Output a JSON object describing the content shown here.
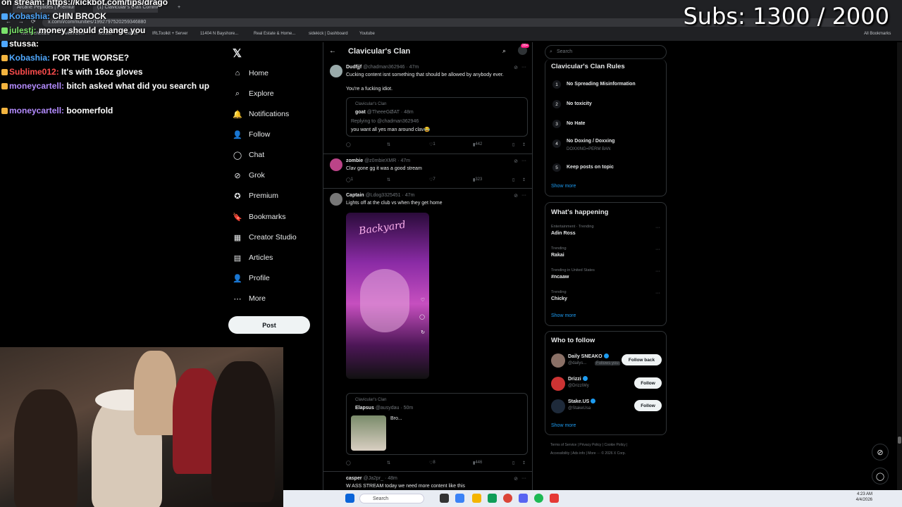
{
  "browser": {
    "tabs": [
      "Arcane Peptides | Premium Re...",
      "(1) Clavicular's Clan Communi...",
      "+"
    ],
    "url": "x.com/i/communities/1992797520259346880",
    "bookmarks": [
      "kick dashboard",
      "Twitter.Com",
      "kickbot",
      "BotKix",
      "IRLToolkit + Server",
      "11404 N Bayshore...",
      "Real Estate & Home...",
      "sidekick | Dashboard",
      "Youtube"
    ],
    "all_bookmarks": "All Bookmarks"
  },
  "overlay": {
    "url_line": "on stream: https://kickbot.com/tips/drago",
    "subs": "Subs: 1300 / 2000",
    "chat": [
      {
        "user": "Kobashia:",
        "user_color": "#4fa8ff",
        "msg": "CHIN BROCK"
      },
      {
        "user": "julestj:",
        "user_color": "#7be36b",
        "msg": "money should change you"
      },
      {
        "user": "stussa:",
        "user_color": "#ffffff",
        "msg": ""
      },
      {
        "user": "Kobashia:",
        "user_color": "#4fa8ff",
        "msg": "FOR THE WORSE?"
      },
      {
        "user": "Sublime012:",
        "user_color": "#ff4d4d",
        "msg": "It's with 16oz gloves"
      },
      {
        "user": "moneycartell:",
        "user_color": "#b48cff",
        "msg": "bitch asked what did you search up"
      },
      {
        "user": "moneycartell:",
        "user_color": "#b48cff",
        "msg": "boomerfold"
      }
    ]
  },
  "nav": {
    "logo": "𝕏",
    "items": [
      "Home",
      "Explore",
      "Notifications",
      "Follow",
      "Chat",
      "Grok",
      "Premium",
      "Bookmarks",
      "Creator Studio",
      "Articles",
      "Profile",
      "More"
    ],
    "icons": [
      "⌂",
      "⌕",
      "🔔",
      "👤",
      "◯",
      "⊘",
      "✪",
      "🔖",
      "▦",
      "▤",
      "👤",
      "⋯"
    ],
    "post": "Post"
  },
  "timeline": {
    "title": "Clavicular's Clan",
    "badge": "20+",
    "tweets": [
      {
        "name": "Dudfjjf",
        "handle": "@chadman362946 · 47m",
        "lines": [
          "Cucking content isnt something that should be allowed by anybody ever.",
          "",
          "You're a fucking idiot."
        ],
        "quote": {
          "community": "Clavicular's Clan",
          "name": "goat",
          "handle": "@TheeeGØAT · 48m",
          "reply": "Replying to @chadman362946",
          "text": "you want all yes man around clav😂"
        },
        "stats": [
          "",
          "",
          "1",
          "442"
        ]
      },
      {
        "name": "zombie",
        "handle": "@z0mbieXMR · 47m",
        "lines": [
          "Clav gone gg it was a good stream"
        ],
        "stats": [
          "1",
          "",
          "7",
          "323"
        ]
      },
      {
        "name": "Captain",
        "handle": "@Ldog3325451 · 47m",
        "lines": [
          "Lights off at the club vs when they get home"
        ],
        "media_caption": "Backyard",
        "quote": {
          "community": "Clavicular's Clan",
          "name": "Elapsus",
          "handle": "@ausydau · 50m",
          "text": "Bro..."
        },
        "stats": [
          "",
          "",
          "8",
          "446"
        ]
      },
      {
        "name": "casper",
        "handle": "@Ja2pr_ · 48m",
        "lines": [
          "W ASS STREAM today we need more content like this"
        ]
      }
    ]
  },
  "right": {
    "search_placeholder": "Search",
    "rules_title": "Clavicular's Clan Rules",
    "rules": [
      {
        "n": "1",
        "text": "No Spreading Misinformation",
        "sub": ""
      },
      {
        "n": "2",
        "text": "No toxicity",
        "sub": ""
      },
      {
        "n": "3",
        "text": "No Hate",
        "sub": ""
      },
      {
        "n": "4",
        "text": "No Doxing / Doxxing",
        "sub": "DOXXING=PERM BAN"
      },
      {
        "n": "5",
        "text": "Keep posts on topic",
        "sub": ""
      }
    ],
    "show_more": "Show more",
    "happening_title": "What's happening",
    "trends": [
      {
        "cat": "Entertainment · Trending",
        "name": "Adin Ross"
      },
      {
        "cat": "Trending",
        "name": "Rakai"
      },
      {
        "cat": "Trending in United States",
        "name": "#ncaaw"
      },
      {
        "cat": "Trending",
        "name": "Chicky"
      }
    ],
    "wtf_title": "Who to follow",
    "follow": [
      {
        "name": "Daily SNEAKO",
        "handle": "@dailys...",
        "tag": "Follows you",
        "btn": "Follow back"
      },
      {
        "name": "Drizzi",
        "handle": "@DrizziWy",
        "tag": "",
        "btn": "Follow"
      },
      {
        "name": "Stake.US",
        "handle": "@StakeUsa",
        "tag": "",
        "btn": "Follow"
      }
    ],
    "footer1": "Terms of Service  |  Privacy Policy  |  Cookie Policy  |",
    "footer2": "Accessibility  |  Ads info  |  More ···  © 2026 X Corp."
  },
  "taskbar": {
    "search": "Search",
    "time": "4:23 AM",
    "date": "4/4/2026"
  },
  "colors": {
    "accent": "#1d9bf0",
    "bg": "#000000",
    "border": "#2f3336",
    "muted": "#71767b"
  }
}
